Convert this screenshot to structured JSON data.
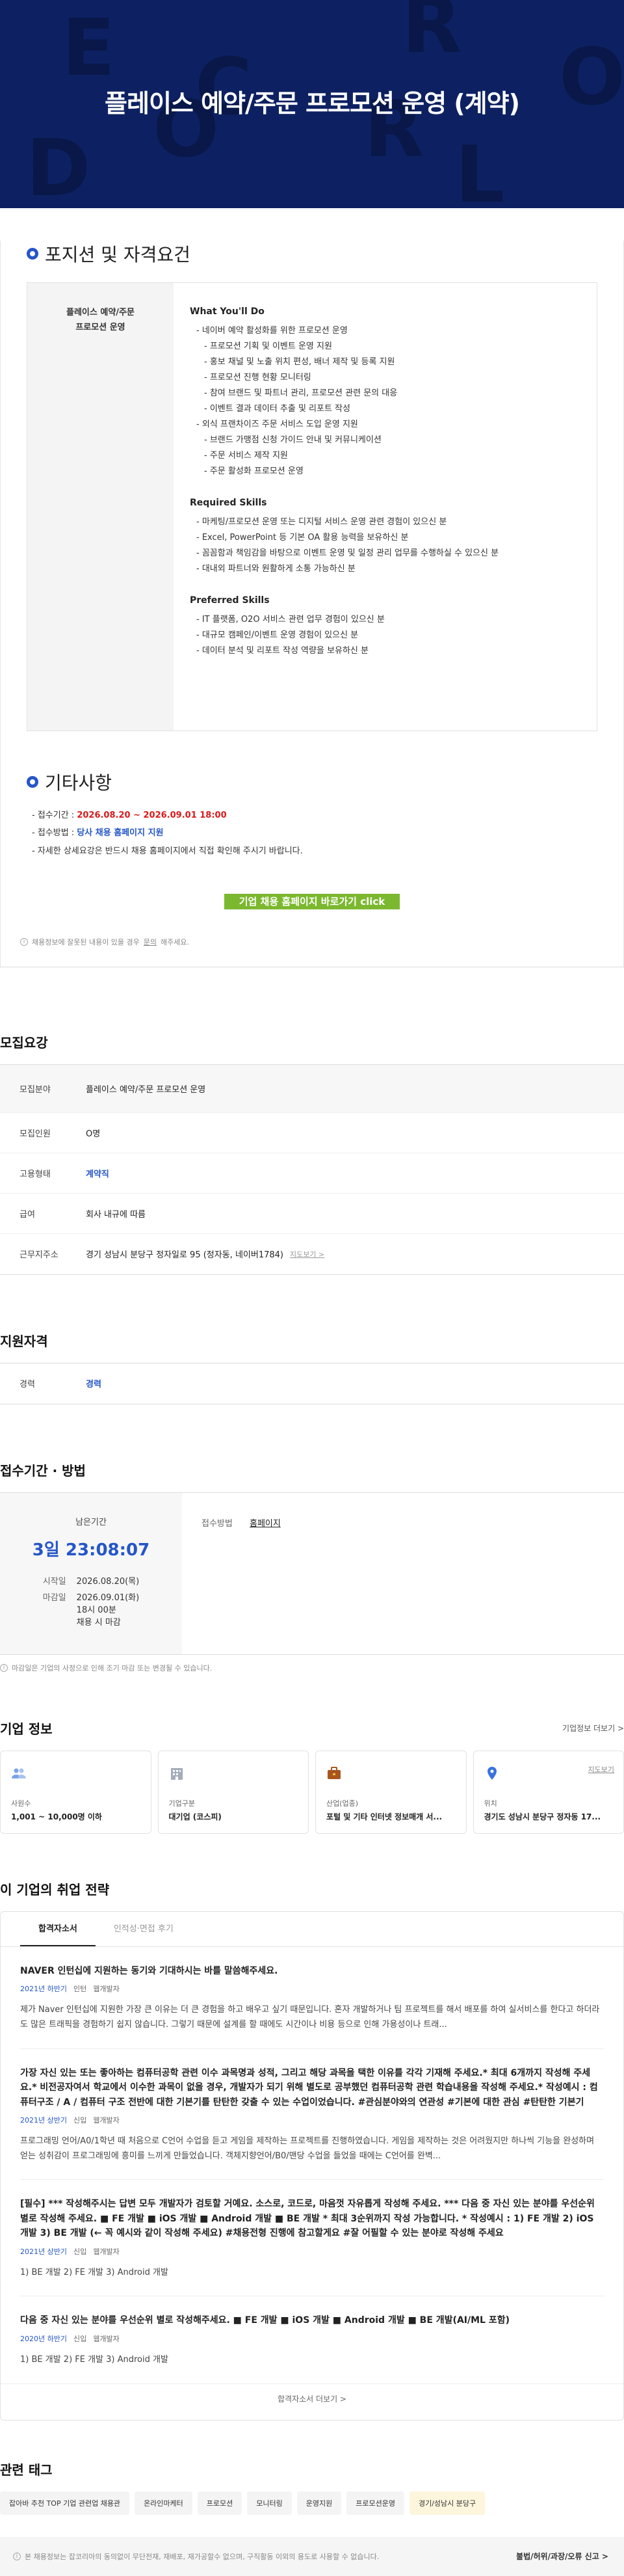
{
  "hero": {
    "title": "플레이스 예약/주문 프로모션 운영 (계약)",
    "bg_letters": [
      "E",
      "R",
      "C",
      "O",
      "R",
      "O",
      "D",
      "L"
    ]
  },
  "position": {
    "section_title": "포지션 및 자격요건",
    "left_label_1": "플레이스 예약/주문",
    "left_label_2": "프로모션 운영",
    "what_title": "What You'll Do",
    "what_items": [
      {
        "text": "- 네이버 예약 활성화를 위한 프로모션 운영",
        "level": 1
      },
      {
        "text": "- 프로모션 기획 및 이벤트 운영 지원",
        "level": 2
      },
      {
        "text": "- 홍보 채널 및 노출 위치 편성, 배너 제작 및 등록 지원",
        "level": 2
      },
      {
        "text": "- 프로모션 진행 현황 모니터링",
        "level": 2
      },
      {
        "text": "- 참여 브랜드 및 파트너 관리, 프로모션 관련 문의 대응",
        "level": 2
      },
      {
        "text": "- 이벤트 결과 데이터 추출 및 리포트 작성",
        "level": 2
      },
      {
        "text": "- 외식 프랜차이즈 주문 서비스 도입 운영 지원",
        "level": 1
      },
      {
        "text": "- 브랜드 가맹점 신청 가이드 안내 및 커뮤니케이션",
        "level": 2
      },
      {
        "text": "- 주문 서비스 제작 지원",
        "level": 2
      },
      {
        "text": "- 주문 활성화 프로모션 운영",
        "level": 2
      }
    ],
    "req_title": "Required Skills",
    "req_items": [
      "- 마케팅/프로모션 운영 또는 디지털 서비스 운영 관련 경험이 있으신 분",
      "- Excel, PowerPoint 등 기본 OA 활용 능력을 보유하신 분",
      "- 꼼꼼함과 책임감을 바탕으로 이벤트 운영 및 일정 관리 업무를 수행하실 수 있으신 분",
      "- 대내외 파트너와 원활하게 소통 가능하신 분"
    ],
    "pref_title": "Preferred Skills",
    "pref_items": [
      "- IT 플랫폼, O2O 서비스 관련 업무 경험이 있으신 분",
      "- 대규모 캠페인/이벤트 운영 경험이 있으신 분",
      "- 데이터 분석 및 리포트 작성 역량을 보유하신 분"
    ]
  },
  "etc": {
    "section_title": "기타사항",
    "period_label": "- 접수기간 : ",
    "period_value": "2026.08.20 ~ 2026.09.01 18:00",
    "method_label": "- 접수방법 : ",
    "method_value": "당사 채용 홈페이지 지원",
    "detail": "- 자세한 상세요강은 반드시 채용 홈페이지에서 직접 확인해 주시기 바랍니다.",
    "apply_button": "기업 채용 홈페이지 바로가기 click",
    "notice_text": "채용정보에 잘못된 내용이 있을 경우",
    "notice_link": "문의",
    "notice_suffix": "해주세요."
  },
  "summary": {
    "title": "모집요강",
    "rows": [
      {
        "key": "모집분야",
        "value": "플레이스 예약/주문 프로모션 운영",
        "shaded": true
      },
      {
        "key": "모집인원",
        "value": "O명"
      },
      {
        "key": "고용형태",
        "value": "계약직",
        "blue": true
      },
      {
        "key": "급여",
        "value": "회사 내규에 따름"
      },
      {
        "key": "근무지주소",
        "value": "경기 성남시 분당구 정자일로 95 (정자동, 네이버1784)",
        "link": "지도보기 >"
      }
    ]
  },
  "qualification": {
    "title": "지원자격",
    "key": "경력",
    "value": "경력"
  },
  "deadline": {
    "title": "접수기간 · 방법",
    "remain_label": "남은기간",
    "remain_value": "3일 23:08:07",
    "start_label": "시작일",
    "start_value": "2026.08.20(목)",
    "end_label": "마감일",
    "end_value": "2026.09.01(화)",
    "end_time": "18시 00분",
    "end_note": "채용 시 마감",
    "method_label": "접수방법",
    "method_value": "홈페이지",
    "notice": "마감일은 기업의 사정으로 인해 조기 마감 또는 변경될 수 있습니다."
  },
  "company": {
    "title": "기업 정보",
    "more": "기업정보 더보기 >",
    "cards": [
      {
        "icon": "people-icon",
        "label": "사원수",
        "value": "1,001 ~ 10,000명 이하"
      },
      {
        "icon": "building-icon",
        "label": "기업구분",
        "value": "대기업 (코스피)"
      },
      {
        "icon": "briefcase-icon",
        "label": "산업(업종)",
        "value": "포털 및 기타 인터넷 정보매개 서..."
      },
      {
        "icon": "pin-icon",
        "label": "위치",
        "value": "경기도 성남시 분당구 정자동 17...",
        "link": "지도보기"
      }
    ]
  },
  "strategy": {
    "title": "이 기업의 취업 전략",
    "tabs": [
      "합격자소서",
      "인적성·면접 후기"
    ],
    "items": [
      {
        "q": "NAVER 인턴십에 지원하는 동기와 기대하시는 바를 말씀해주세요.",
        "year": "2021년 하반기",
        "type": "인턴",
        "job": "웹개발자",
        "a": "제가 Naver 인턴십에 지원한 가장 큰 이유는 더 큰 경험을 하고 배우고 싶기 때문입니다. 혼자 개발하거나 팀 프로젝트를 해서 배포를 하여 실서비스를 한다고 하더라도 많은 트래픽을 경험하기 쉽지 않습니다. 그렇기 때문에 설계를 할 때에도 시간이나 비용 등으로 인해 가용성이나 트래..."
      },
      {
        "q": "가장 자신 있는 또는 좋아하는 컴퓨터공학 관련 이수 과목명과 성적, 그리고 해당 과목을 택한 이유를 각각 기재해 주세요.* 최대 6개까지 작성해 주세요.* 비전공자여서 학교에서 이수한 과목이 없을 경우, 개발자가 되기 위해 별도로 공부했던 컴퓨터공학 관련 학습내용을 작성해 주세요.* 작성예시 : 컴퓨터구조 / A / 컴퓨터 구조 전반에 대한 기본기를 탄탄한 갖출 수 있는 수업이었습니다. #관심분야와의 연관성 #기본에 대한 관심 #탄탄한 기본기",
        "year": "2021년 상반기",
        "type": "신입",
        "job": "웹개발자",
        "a": "프로그래밍 언어/A0/1학년 때 처음으로 C언어 수업을 듣고 게임을 제작하는 프로젝트를 진행하였습니다. 게임을 제작하는 것은 어려웠지만 하나씩 기능을 완성하며 얻는 성취감이 프로그래밍에 흥미를 느끼게 만들었습니다. 객체지향언어/B0/맨당 수업을 들었을 때에는 C언어를 완벽..."
      },
      {
        "q": "[필수] *** 작성해주시는 답변 모두 개발자가 검토할 거예요. 소스로, 코드로, 마음껏 자유롭게 작성해 주세요. *** 다음 중 자신 있는 분야를 우선순위 별로 작성해 주세요. ■ FE 개발 ■ iOS 개발 ■ Android 개발 ■ BE 개발 * 최대 3순위까지 작성 가능합니다. * 작성예시 : 1) FE 개발 2) iOS 개발 3) BE 개발 (← 꼭 예시와 같이 작성해 주세요) #채용전형 진행에 참고할게요 #잘 어필할 수 있는 분야로 작성해 주세요",
        "year": "2021년 상반기",
        "type": "신입",
        "job": "웹개발자",
        "a": "1) BE 개발 2) FE 개발 3) Android 개발"
      },
      {
        "q": "다음 중 자신 있는 분야를 우선순위 별로 작성해주세요. ■ FE 개발 ■ iOS 개발 ■ Android 개발 ■ BE 개발(AI/ML 포함)",
        "year": "2020년 하반기",
        "type": "신입",
        "job": "웹개발자",
        "a": "1) BE 개발 2) FE 개발 3) Android 개발"
      }
    ],
    "view_more": "합격자소서 더보기 >"
  },
  "tags": {
    "title": "관련 태그",
    "items": [
      {
        "label": "잡아바 추천 TOP 기업 관련업 채용관",
        "hl": false
      },
      {
        "label": "온라인마케터",
        "hl": false
      },
      {
        "label": "프로모션",
        "hl": false
      },
      {
        "label": "모니터링",
        "hl": false
      },
      {
        "label": "운영지원",
        "hl": false
      },
      {
        "label": "프로모션운영",
        "hl": false
      },
      {
        "label": "경기/성남시 분당구",
        "hl": true
      }
    ]
  },
  "footer": {
    "notice": "본 채용정보는 잡코리아의 동의없이 무단전재, 재배포, 재가공할수 없으며, 구직활동 이외의 용도로 사용할 수 없습니다.",
    "right": "불법/허위/과장/오류 신고 >"
  },
  "colors": {
    "hero_bg": "#0d2162",
    "accent_blue": "#2556c8",
    "apply_green": "#7cb82f",
    "red": "#d81a1a"
  }
}
